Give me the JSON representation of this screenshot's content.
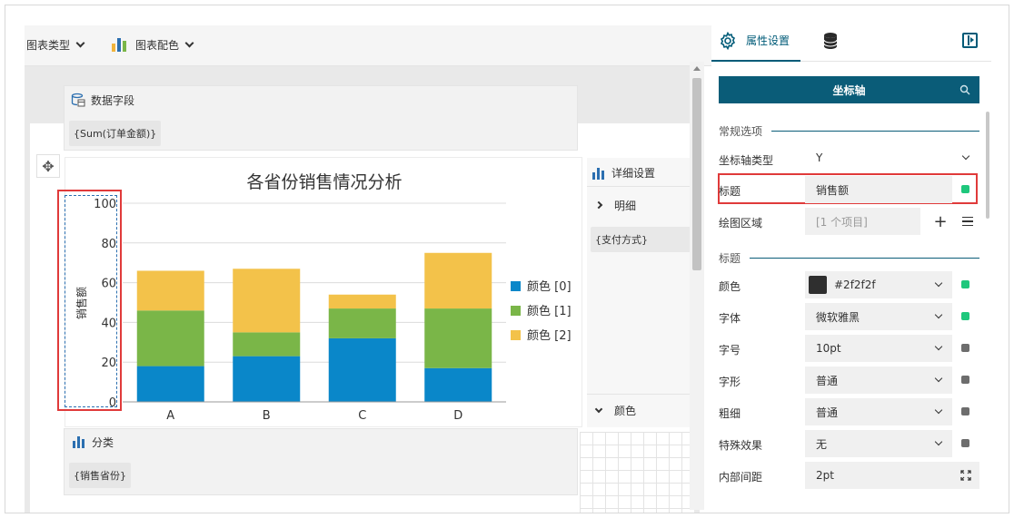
{
  "toolbar": {
    "chart_type_label": "图表类型",
    "chart_color_label": "图表配色",
    "bar_icon_colors": [
      "#f0b43c",
      "#2b6fb0",
      "#7ab648"
    ]
  },
  "canvas": {
    "data_field_title": "数据字段",
    "data_field_chip": "{Sum(订单金额)}",
    "category_title": "分类",
    "category_chip": "{销售省份}",
    "detail_title": "详细设置",
    "detail_sub": "明细",
    "detail_chip": "{支付方式}",
    "color_section": "颜色"
  },
  "chart_data": {
    "type": "bar",
    "stacked": true,
    "title": "各省份销售情况分析",
    "ylabel": "销售额",
    "xlabel": "",
    "categories": [
      "A",
      "B",
      "C",
      "D"
    ],
    "ylim": [
      0,
      100
    ],
    "yticks": [
      0,
      20,
      40,
      60,
      80,
      100
    ],
    "grid": true,
    "legend_position": "right",
    "series": [
      {
        "name": "颜色 [0]",
        "color": "#0a87c9",
        "values": [
          18,
          23,
          32,
          17
        ]
      },
      {
        "name": "颜色 [1]",
        "color": "#7ab648",
        "values": [
          28,
          12,
          15,
          30
        ]
      },
      {
        "name": "颜色 [2]",
        "color": "#f3c24a",
        "values": [
          20,
          32,
          7,
          28
        ]
      }
    ]
  },
  "panel": {
    "tab_props": "属性设置",
    "axis_button": "坐标轴",
    "section_general": "常规选项",
    "axis_type_label": "坐标轴类型",
    "axis_type_value": "Y",
    "title_label": "标题",
    "title_value": "销售额",
    "plot_area_label": "绘图区域",
    "plot_area_value": "[1 个项目]",
    "section_title": "标题",
    "color_label": "颜色",
    "color_value": "#2f2f2f",
    "font_label": "字体",
    "font_value": "微软雅黑",
    "size_label": "字号",
    "size_value": "10pt",
    "style_label": "字形",
    "style_value": "普通",
    "weight_label": "粗细",
    "weight_value": "普通",
    "effect_label": "特殊效果",
    "effect_value": "无",
    "padding_label": "内部间距",
    "padding_value": "2pt",
    "active_dot_color": "#1ec77c",
    "inactive_dot_color": "#6d6d6d"
  }
}
